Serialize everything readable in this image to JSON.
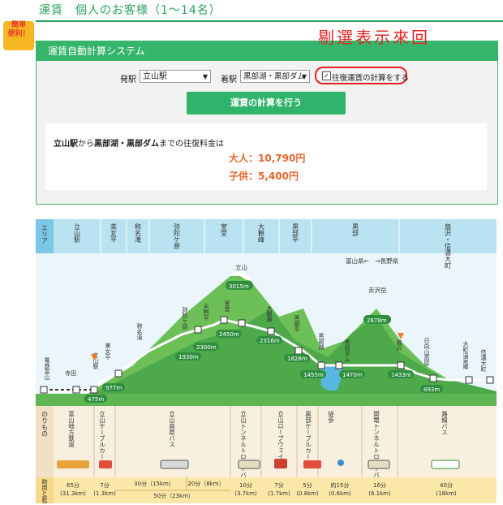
{
  "page": {
    "title": "運賃　個人のお客様（1〜14名）"
  },
  "badge": {
    "line1": "簡単",
    "line2": "便利！"
  },
  "note": {
    "text": "剔選表示來回"
  },
  "calc": {
    "header": "運賃自動計算システム",
    "from_label": "発駅",
    "from_value": "立山駅",
    "to_label": "着駅",
    "to_value": "黒部湖・黒部ダム",
    "roundtrip_label": "往復運賃の計算をする",
    "roundtrip_checked": true,
    "button_label": "運賃の計算を行う",
    "result": {
      "from": "立山駅",
      "from_suffix": "から",
      "to": "黒部湖・黒部ダム",
      "to_suffix": "までの往復料金は",
      "adult_label": "大人：",
      "adult_fare": "10,790円",
      "child_label": "子供：",
      "child_fare": "5,400円"
    }
  },
  "route_map": {
    "area_header": "エリア",
    "areas": [
      "立山駅",
      "美女平",
      "称名滝",
      "弥陀ケ原",
      "室堂",
      "大観峰",
      "黒部平",
      "黒部",
      "扇沢・信濃大町"
    ],
    "border_label": "富山県←　→長野県",
    "peaks": [
      {
        "name": "立山",
        "elevation": "3015m"
      },
      {
        "name": "赤沢岳",
        "elevation": "2678m"
      }
    ],
    "stations": [
      {
        "name": "電鉄富山",
        "elevation": ""
      },
      {
        "name": "寺田",
        "elevation": ""
      },
      {
        "name": "立山駅",
        "elevation": "475m"
      },
      {
        "name": "美女平",
        "elevation": "977m"
      },
      {
        "name": "称名滝",
        "elevation": ""
      },
      {
        "name": "弥陀ケ原",
        "elevation": "1930m"
      },
      {
        "name": "天狗平",
        "elevation": "2300m"
      },
      {
        "name": "室堂",
        "elevation": "2450m"
      },
      {
        "name": "大観峰",
        "elevation": "2316m"
      },
      {
        "name": "黒部平",
        "elevation": "1828m"
      },
      {
        "name": "黒部湖",
        "elevation": "1455m"
      },
      {
        "name": "黒部ダム",
        "elevation": "1470m"
      },
      {
        "name": "扇沢",
        "elevation": "1433m"
      },
      {
        "name": "日向山高原",
        "elevation": "893m"
      },
      {
        "name": "大町温泉郷",
        "elevation": ""
      },
      {
        "name": "信濃大町",
        "elevation": ""
      }
    ],
    "transport_header": "のりもの",
    "transports": [
      "富山地方鉄道",
      "立山ケーブルカー",
      "立山高原バス",
      "立山トンネルトロリーバス",
      "立山ロープウェイ",
      "黒部ケーブルカー",
      "徒歩",
      "関電トンネルトロリーバス",
      "路線バス"
    ],
    "time_header": "時間と距離",
    "times": [
      {
        "t": "65分",
        "d": "(31.3km)"
      },
      {
        "t": "7分",
        "d": "(1.3km)"
      },
      {
        "t": "30分（15km）",
        "d": ""
      },
      {
        "t": "20分（8km）",
        "d": ""
      },
      {
        "t": "50分（23km）",
        "d": ""
      },
      {
        "t": "10分",
        "d": "(3.7km)"
      },
      {
        "t": "7分",
        "d": "(1.7km)"
      },
      {
        "t": "5分",
        "d": "(0.8km)"
      },
      {
        "t": "約15分",
        "d": "(0.6km)"
      },
      {
        "t": "16分",
        "d": "(6.1km)"
      },
      {
        "t": "40分",
        "d": "(18km)"
      }
    ]
  }
}
